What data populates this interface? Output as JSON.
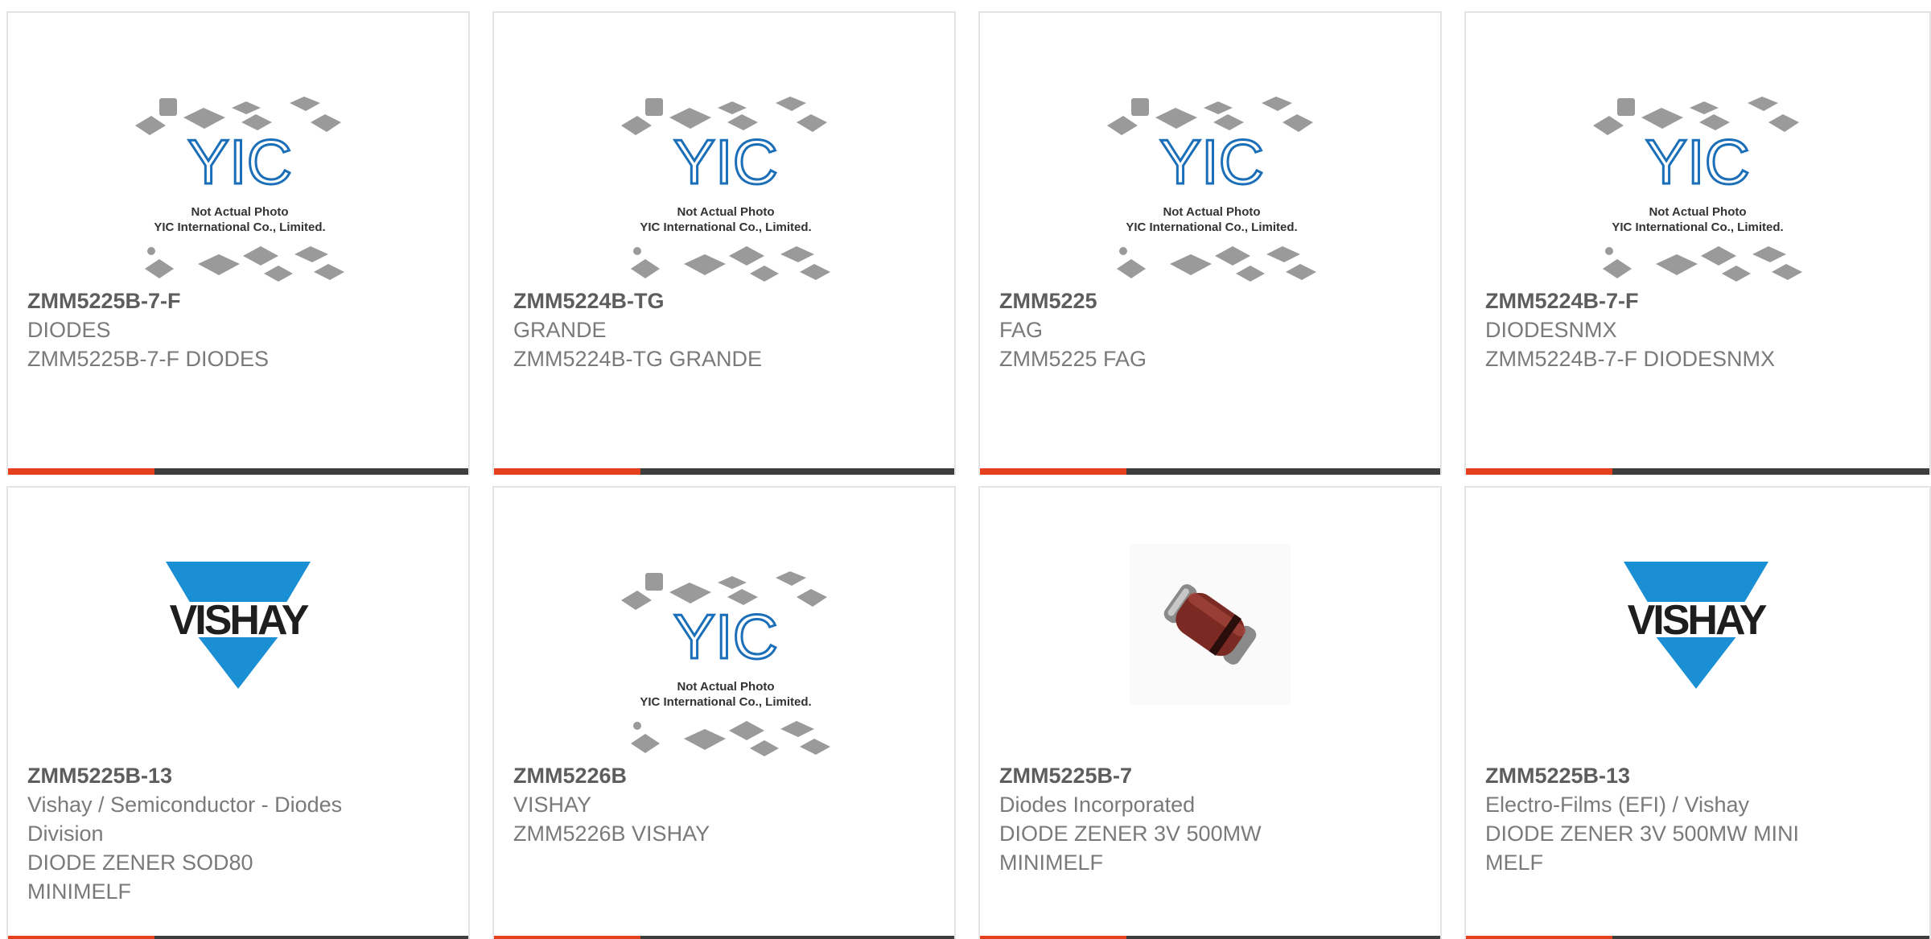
{
  "colors": {
    "accent": "#e4401c",
    "bar": "#3d3d3d",
    "border": "#e4e4e4",
    "text": "#7a7a7a",
    "title": "#5d5d5d",
    "vishay_blue": "#1a8fd4"
  },
  "yic_logo": {
    "brand": "YIC",
    "caption_line1": "Not Actual Photo",
    "caption_line2": "YIC International Co., Limited."
  },
  "vishay_logo": {
    "brand": "VISHAY"
  },
  "products": [
    {
      "part": "ZMM5225B-7-F",
      "manufacturer": "DIODES",
      "description": "ZMM5225B-7-F DIODES",
      "image": "yic-placeholder"
    },
    {
      "part": "ZMM5224B-TG",
      "manufacturer": "GRANDE",
      "description": "ZMM5224B-TG GRANDE",
      "image": "yic-placeholder"
    },
    {
      "part": "ZMM5225",
      "manufacturer": "FAG",
      "description": "ZMM5225 FAG",
      "image": "yic-placeholder"
    },
    {
      "part": "ZMM5224B-7-F",
      "manufacturer": "DIODESNMX",
      "description": "ZMM5224B-7-F DIODESNMX",
      "image": "yic-placeholder"
    },
    {
      "part": "ZMM5225B-13",
      "manufacturer_line1": "Vishay / Semiconductor - Diodes",
      "manufacturer_line2": "Division",
      "description_line1": "DIODE ZENER SOD80",
      "description_line2": "MINIMELF",
      "image": "vishay-logo"
    },
    {
      "part": "ZMM5226B",
      "manufacturer": "VISHAY",
      "description": "ZMM5226B VISHAY",
      "image": "yic-placeholder"
    },
    {
      "part": "ZMM5225B-7",
      "manufacturer": "Diodes Incorporated",
      "description_line1": "DIODE ZENER 3V 500MW",
      "description_line2": "MINIMELF",
      "image": "diode-photo"
    },
    {
      "part": "ZMM5225B-13",
      "manufacturer": "Electro-Films (EFI) / Vishay",
      "description_line1": "DIODE ZENER 3V 500MW MINI",
      "description_line2": "MELF",
      "image": "vishay-logo"
    }
  ]
}
